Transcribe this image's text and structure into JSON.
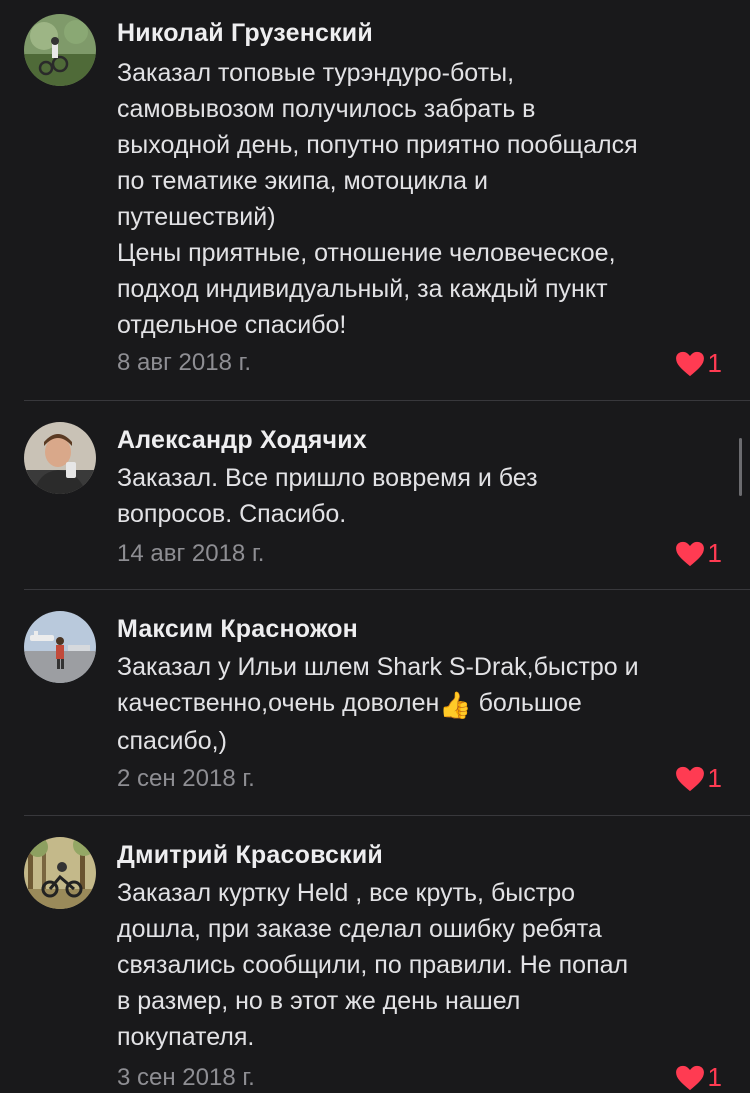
{
  "reviews": [
    {
      "author": "Николай Грузенский",
      "lines": [
        "Заказал топовые турэндуро-боты,",
        "самовывозом получилось забрать в",
        "выходной день, попутно приятно пообщался",
        "по тематике экипа, мотоцикла и",
        "путешествий)",
        "Цены приятные, отношение человеческое,",
        "подход индивидуальный, за каждый пункт",
        "отдельное спасибо!"
      ],
      "date": "8 авг 2018 г.",
      "likes": "1"
    },
    {
      "author": "Александр Ходячих",
      "lines": [
        "Заказал. Все пришло вовремя и без",
        "вопросов. Спасибо."
      ],
      "date": "14 авг 2018 г.",
      "likes": "1"
    },
    {
      "author": "Максим Красножон",
      "lines": [
        "Заказал у Ильи шлем Shark S-Drak,быстро и",
        "качественно,очень доволен",
        "спасибо,)"
      ],
      "line2_suffix": " большое",
      "emoji": "👍",
      "date": "2 сен 2018 г.",
      "likes": "1"
    },
    {
      "author": "Дмитрий Красовский",
      "lines": [
        "Заказал куртку Held , все круть, быстро",
        "дошла, при заказе сделал ошибку ребята",
        "связались сообщили, по правили. Не попал",
        "в размер, но в этот же день нашел",
        "покупателя."
      ],
      "date": "3 сен 2018 г.",
      "likes": "1"
    }
  ],
  "colors": {
    "background": "#19191b",
    "like_accent": "#ff3b52",
    "secondary_text": "#8e8e93"
  },
  "icons": {
    "like": "heart-icon"
  }
}
